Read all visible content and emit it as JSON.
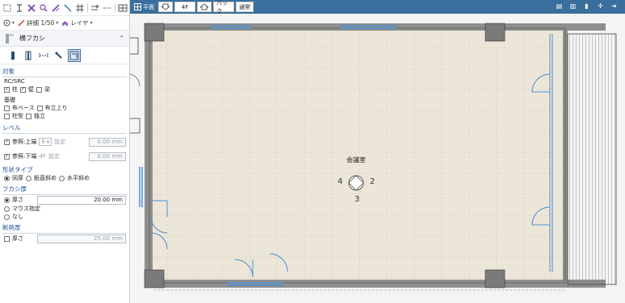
{
  "toolbar": {
    "icons": [
      "select-icon",
      "pin-icon",
      "cross-icon",
      "magnify-icon",
      "slash-icon",
      "line-icon",
      "grid-icon",
      "arrow-icon",
      "dashed-line-icon",
      "layout-icon"
    ],
    "detail_label": "詳細 1/50",
    "layer_label": "レイヤ"
  },
  "panel": {
    "title": "横フカシ",
    "section_target": "対象",
    "rc_label": "RC/SRC",
    "rc_items": [
      {
        "label": "柱",
        "checked": true
      },
      {
        "label": "壁",
        "checked": true
      },
      {
        "label": "梁",
        "checked": false
      }
    ],
    "foundation_label": "基礎",
    "foundation_items": [
      {
        "label": "布ベース",
        "checked": false
      },
      {
        "label": "布立上り",
        "checked": false
      },
      {
        "label": "柱型",
        "checked": false
      },
      {
        "label": "独立",
        "checked": false
      }
    ],
    "section_level": "レベル",
    "upper": {
      "label": "参照:上端",
      "select": "R",
      "btn": "設定",
      "value": "0.00 mm"
    },
    "lower": {
      "label": "参照:下端",
      "floor": "4F",
      "btn": "設定",
      "value": "0.00 mm"
    },
    "section_shape": "形状タイプ",
    "shape_options": [
      "同厚",
      "鉛直斜め",
      "水平斜め"
    ],
    "section_thickness": "フカシ厚",
    "thickness_label": "厚さ",
    "thickness_value": "20.00 mm",
    "mouse_label": "マウス指定",
    "none_label": "なし",
    "section_insulation": "断熱厚",
    "insulation_label": "厚さ",
    "insulation_value": "25.00 mm"
  },
  "canvas": {
    "view_label": "平面",
    "floor": "4F",
    "back_label": "バック",
    "mode_label": "通常",
    "room_name": "会議室",
    "num_left": "4",
    "num_right": "2",
    "num_bottom": "3",
    "colors": {
      "floor_fill": "#ece6d8",
      "wall": "#8e8e8e",
      "window_blue": "#4a90d6",
      "grid": "#c9c2b0",
      "top_bar": "#3a6e9c"
    }
  }
}
